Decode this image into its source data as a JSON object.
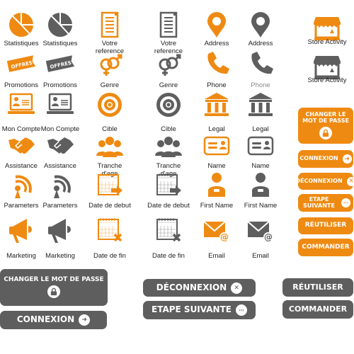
{
  "colors": {
    "orange": "#ee8a12",
    "gray": "#5e5e5e"
  },
  "offres_tag": "OFFRES",
  "grid": [
    [
      {
        "label": "Statistiques",
        "icon": "pie-chart-icon",
        "c": "o"
      },
      {
        "label": "Statistiques",
        "icon": "pie-chart-icon",
        "c": "g"
      },
      {
        "label": "Votre reference",
        "icon": "document-icon",
        "c": "o"
      },
      {
        "label": "Votre reference",
        "icon": "document-icon",
        "c": "g"
      },
      {
        "label": "Address",
        "icon": "map-pin-icon",
        "c": "o"
      },
      {
        "label": "Address",
        "icon": "map-pin-icon",
        "c": "g"
      }
    ],
    [
      {
        "label": "Promotions",
        "icon": "offers-tag-icon",
        "c": "o"
      },
      {
        "label": "Promotions",
        "icon": "offers-tag-icon",
        "c": "g"
      },
      {
        "label": "Genre",
        "icon": "gender-icon",
        "c": "o"
      },
      {
        "label": "Genre",
        "icon": "gender-icon",
        "c": "g"
      },
      {
        "label": "Phone",
        "icon": "phone-icon",
        "c": "o"
      },
      {
        "label": "Phone",
        "icon": "phone-icon",
        "c": "g",
        "light": true
      }
    ],
    [
      {
        "label": "Mon Compte",
        "icon": "laptop-account-icon",
        "c": "o"
      },
      {
        "label": "Mon Compte",
        "icon": "laptop-account-icon",
        "c": "g"
      },
      {
        "label": "Cible",
        "icon": "target-icon",
        "c": "o"
      },
      {
        "label": "Cible",
        "icon": "target-icon",
        "c": "g"
      },
      {
        "label": "Legal",
        "icon": "courthouse-icon",
        "c": "o"
      },
      {
        "label": "Legal",
        "icon": "courthouse-icon",
        "c": "g"
      }
    ],
    [
      {
        "label": "Assistance",
        "icon": "handshake-icon",
        "c": "o"
      },
      {
        "label": "Assistance",
        "icon": "handshake-icon",
        "c": "g"
      },
      {
        "label": "Tranche d'age",
        "icon": "people-group-icon",
        "c": "o"
      },
      {
        "label": "Tranche d'age",
        "icon": "people-group-icon",
        "c": "g"
      },
      {
        "label": "Name",
        "icon": "id-card-icon",
        "c": "o"
      },
      {
        "label": "Name",
        "icon": "id-card-icon",
        "c": "g"
      }
    ],
    [
      {
        "label": "Parameters",
        "icon": "antenna-icon",
        "c": "o"
      },
      {
        "label": "Parameters",
        "icon": "antenna-icon",
        "c": "g"
      },
      {
        "label": "Date de debut",
        "icon": "calendar-arrow-icon",
        "c": "o"
      },
      {
        "label": "Date de debut",
        "icon": "calendar-arrow-icon",
        "c": "g"
      },
      {
        "label": "First Name",
        "icon": "person-badge-icon",
        "c": "o"
      },
      {
        "label": "First Name",
        "icon": "person-badge-icon",
        "c": "g"
      }
    ],
    [
      {
        "label": "Marketing",
        "icon": "megaphone-icon",
        "c": "o"
      },
      {
        "label": "Marketing",
        "icon": "megaphone-icon",
        "c": "g"
      },
      {
        "label": "Date de fin",
        "icon": "calendar-x-icon",
        "c": "o"
      },
      {
        "label": "Date de fin",
        "icon": "calendar-x-icon",
        "c": "g"
      },
      {
        "label": "Email",
        "icon": "email-at-icon",
        "c": "o"
      },
      {
        "label": "Email",
        "icon": "email-at-icon",
        "c": "g"
      }
    ]
  ],
  "store": [
    {
      "label": "Store Activity",
      "icon": "storefront-icon",
      "c": "o"
    },
    {
      "label": "Store Activity",
      "icon": "storefront-icon",
      "c": "g"
    }
  ],
  "buttons": [
    {
      "label": "CHANGER LE MOT DE PASSE",
      "c": "o",
      "icon": "padlock-icon"
    },
    {
      "label": "CONNEXION",
      "c": "o",
      "icon": "arrow-right-icon"
    },
    {
      "label": "DÉCONNEXION",
      "c": "o",
      "icon": "close-icon"
    },
    {
      "label": "ETAPE SUIVANTE",
      "c": "o",
      "icon": "next-icon"
    },
    {
      "label": "RÉUTILISER",
      "c": "o",
      "icon": ""
    },
    {
      "label": "COMMANDER",
      "c": "o",
      "icon": ""
    },
    {
      "label": "CHANGER LE MOT DE PASSE",
      "c": "g",
      "icon": "padlock-icon"
    },
    {
      "label": "CONNEXION",
      "c": "g",
      "icon": "arrow-right-icon"
    },
    {
      "label": "DÉCONNEXION",
      "c": "g",
      "icon": "close-icon"
    },
    {
      "label": "ETAPE SUIVANTE",
      "c": "g",
      "icon": "next-icon"
    },
    {
      "label": "RÉUTILISER",
      "c": "g",
      "icon": ""
    },
    {
      "label": "COMMANDER",
      "c": "g",
      "icon": ""
    }
  ]
}
